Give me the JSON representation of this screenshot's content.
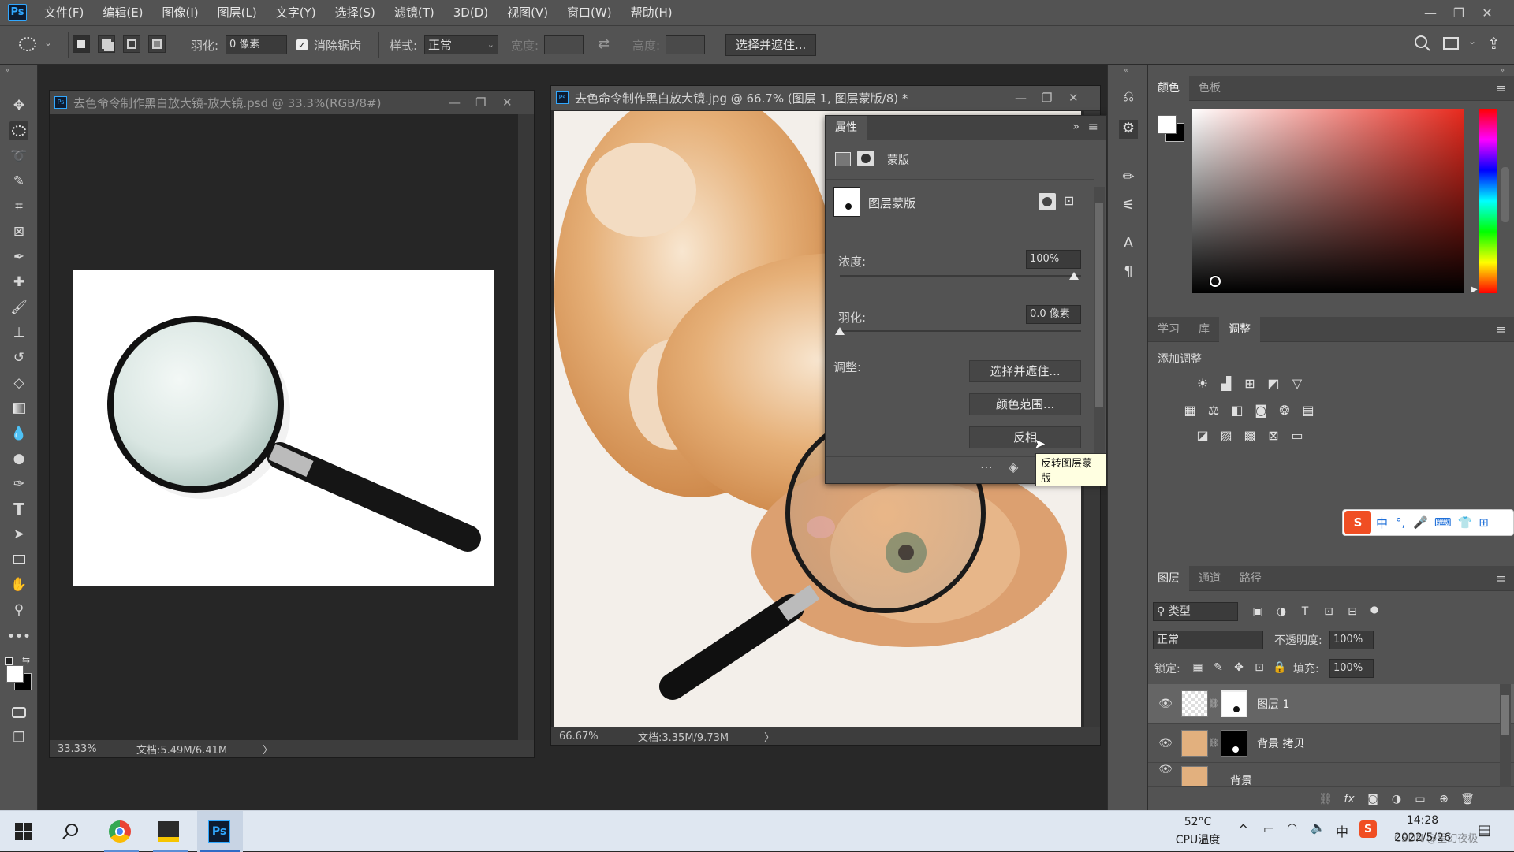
{
  "app": {
    "logo": "Ps",
    "win_controls": [
      "—",
      "❐",
      "✕"
    ]
  },
  "menu": [
    "文件(F)",
    "编辑(E)",
    "图像(I)",
    "图层(L)",
    "文字(Y)",
    "选择(S)",
    "滤镜(T)",
    "3D(D)",
    "视图(V)",
    "窗口(W)",
    "帮助(H)"
  ],
  "options": {
    "feather_label": "羽化:",
    "feather_value": "0 像素",
    "antialias_label": "消除锯齿",
    "antialias_checked": true,
    "style_label": "样式:",
    "style_value": "正常",
    "width_label": "宽度:",
    "height_label": "高度:",
    "select_mask_button": "选择并遮住..."
  },
  "doc1": {
    "title": "去色命令制作黑白放大镜-放大镜.psd @ 33.3%(RGB/8#)",
    "zoom": "33.33%",
    "doc_size": "文档:5.49M/6.41M",
    "arrow": "〉"
  },
  "doc2": {
    "title": "去色命令制作黑白放大镜.jpg @ 66.7% (图层 1, 图层蒙版/8) *",
    "zoom": "66.67%",
    "doc_size": "文档:3.35M/9.73M",
    "arrow": "〉"
  },
  "properties": {
    "tab": "属性",
    "header_label": "蒙版",
    "mask_label": "图层蒙版",
    "density_label": "浓度:",
    "density_value": "100%",
    "feather_label": "羽化:",
    "feather_value": "0.0 像素",
    "adjust_label": "调整:",
    "select_mask_button": "选择并遮住...",
    "color_range_button": "颜色范围...",
    "invert_button": "反相",
    "tooltip": "反转图层蒙版"
  },
  "color_panel": {
    "tabs": [
      "颜色",
      "色板"
    ],
    "active_tab": 0,
    "fg_color": "#ffffff",
    "bg_color": "#000000"
  },
  "adjust_panel": {
    "tabs": [
      "学习",
      "库",
      "调整"
    ],
    "active_tab": 2,
    "title": "添加调整",
    "row1_icons": [
      "brightness-icon",
      "levels-icon",
      "curves-icon",
      "exposure-icon",
      "vibrance-icon"
    ],
    "row2_icons": [
      "hue-saturation-icon",
      "color-balance-icon",
      "black-white-icon",
      "photo-filter-icon",
      "channel-mixer-icon",
      "color-lookup-icon"
    ],
    "row3_icons": [
      "invert-icon",
      "posterize-icon",
      "threshold-icon",
      "selective-color-icon",
      "gradient-map-icon"
    ]
  },
  "ime": {
    "label": "中",
    "items": [
      "°,",
      "🎤",
      "⌨",
      "👕",
      "⊞"
    ]
  },
  "layers_panel": {
    "tabs": [
      "图层",
      "通道",
      "路径"
    ],
    "active_tab": 0,
    "filter_label": "类型",
    "blend_mode": "正常",
    "opacity_label": "不透明度:",
    "opacity_value": "100%",
    "lock_label": "锁定:",
    "fill_label": "填充:",
    "fill_value": "100%",
    "layers": [
      {
        "name": "图层 1",
        "visible": true,
        "selected": true
      },
      {
        "name": "背景 拷贝",
        "visible": true,
        "selected": false
      },
      {
        "name": "背景",
        "visible": true,
        "selected": false
      }
    ],
    "footer_icons": [
      "link-icon",
      "fx-icon",
      "mask-icon",
      "adjustment-icon",
      "group-icon",
      "new-layer-icon",
      "trash-icon"
    ]
  },
  "taskbar": {
    "weather_temp": "52°C",
    "weather_label": "CPU温度",
    "time": "14:28",
    "date": "2022/5/26",
    "ime_lang": "中",
    "watermark": "CSDN @星幻夜极"
  }
}
